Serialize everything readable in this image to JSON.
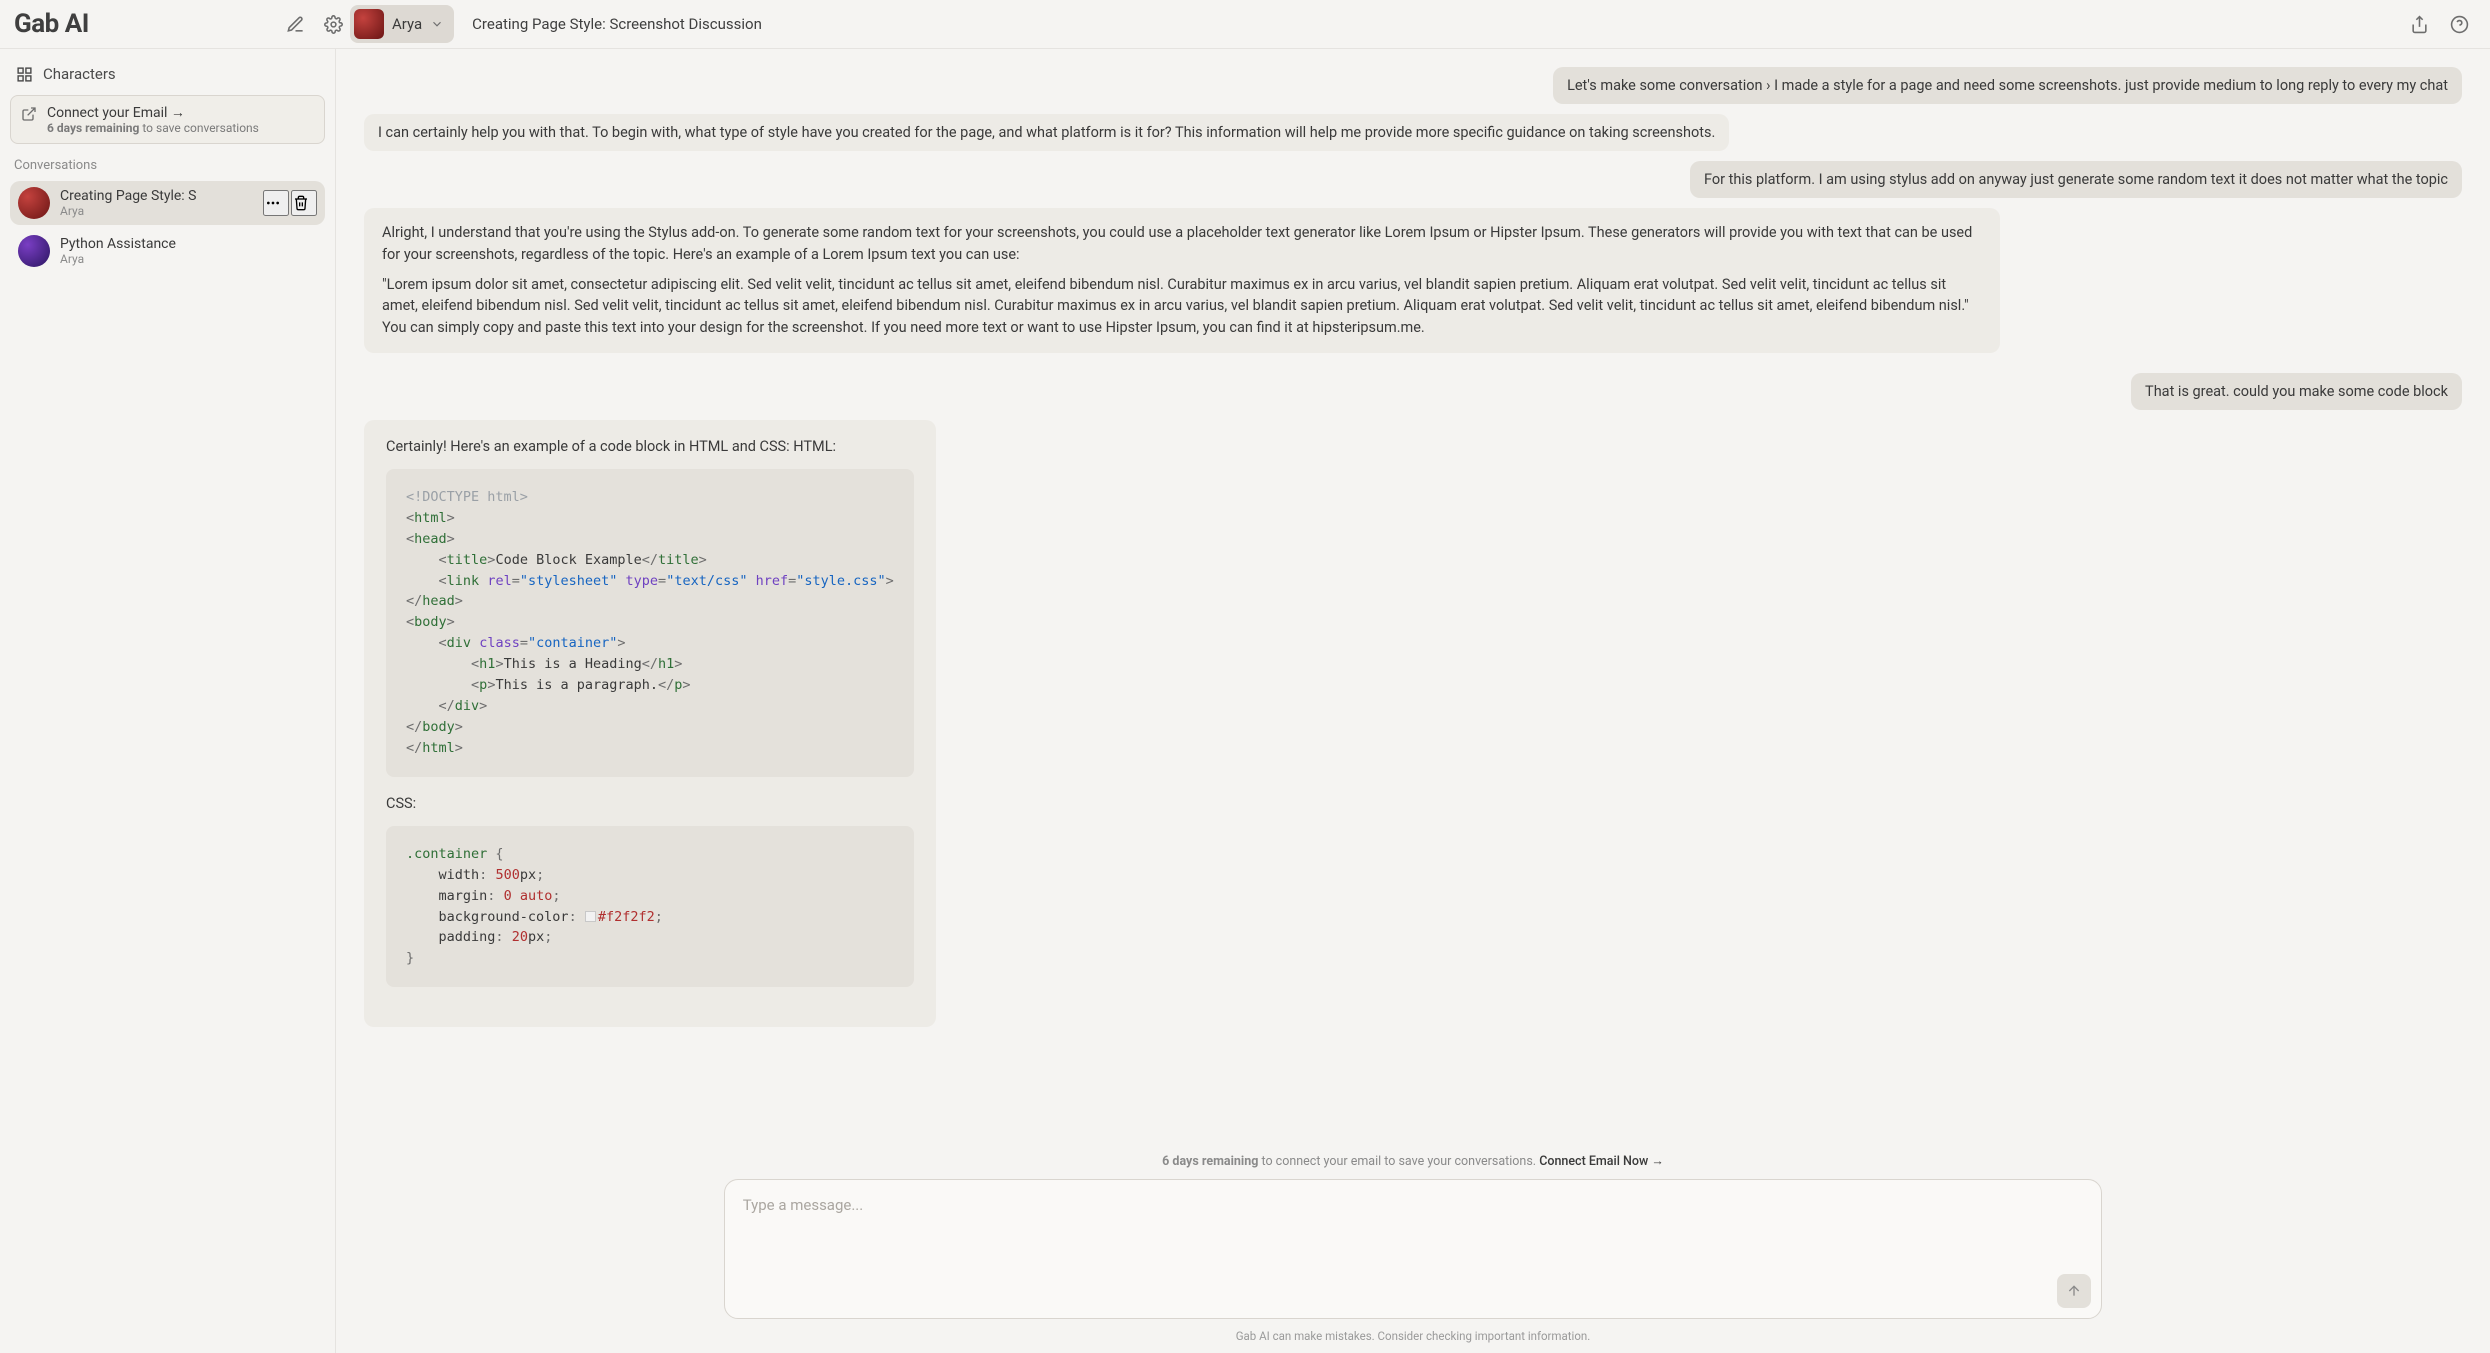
{
  "brand": "Gab AI",
  "header": {
    "persona_name": "Arya",
    "title": "Creating Page Style: Screenshot Discussion"
  },
  "sidebar": {
    "characters_label": "Characters",
    "connect": {
      "line1": "Connect your Email →",
      "line2_prefix": "6 days remaining",
      "line2_suffix": " to save conversations"
    },
    "group_label": "Conversations",
    "items": [
      {
        "title": "Creating Page Style: S",
        "sub": "Arya",
        "active": true,
        "has_actions": true
      },
      {
        "title": "Python Assistance",
        "sub": "Arya",
        "active": false,
        "has_actions": false
      }
    ]
  },
  "messages": {
    "u1": "Let's make some conversation › I made a style for a page and need some screenshots. just provide medium to long reply to every my chat",
    "a1": "I can certainly help you with that. To begin with, what type of style have you created for the page, and what platform is it for? This information will help me provide more specific guidance on taking screenshots.",
    "u2": "For this platform. I am using stylus add on anyway just generate some random text it does not matter what the topic",
    "a2_intro": "Alright, I understand that you're using the Stylus add-on. To generate some random text for your screenshots, you could use a placeholder text generator like Lorem Ipsum or Hipster Ipsum. These generators will provide you with text that can be used for your screenshots, regardless of the topic. Here's an example of a Lorem Ipsum text you can use:",
    "a2_quote": "\"Lorem ipsum dolor sit amet, consectetur adipiscing elit. Sed velit velit, tincidunt ac tellus sit amet, eleifend bibendum nisl. Curabitur maximus ex in arcu varius, vel blandit sapien pretium. Aliquam erat volutpat. Sed velit velit, tincidunt ac tellus sit amet, eleifend bibendum nisl. Sed velit velit, tincidunt ac tellus sit amet, eleifend bibendum nisl. Curabitur maximus ex in arcu varius, vel blandit sapien pretium. Aliquam erat volutpat. Sed velit velit, tincidunt ac tellus sit amet, eleifend bibendum nisl.\" You can simply copy and paste this text into your design for the screenshot. If you need more text or want to use Hipster Ipsum, you can find it at hipsteripsum.me.",
    "u3": "That is great. could you make some code block",
    "a3_intro": "Certainly! Here's an example of a code block in HTML and CSS: HTML:",
    "css_label": "CSS:"
  },
  "code": {
    "html": {
      "doctype": "<!DOCTYPE html>",
      "html_open": "html",
      "head_open": "head",
      "title_tag": "title",
      "title_text": "Code Block Example",
      "link_tag": "link",
      "rel_attr": "rel",
      "rel_val": "\"stylesheet\"",
      "type_attr": "type",
      "type_val": "\"text/css\"",
      "href_attr": "href",
      "href_val": "\"style.css\"",
      "body_open": "body",
      "div_tag": "div",
      "class_attr": "class",
      "class_val": "\"container\"",
      "h1_tag": "h1",
      "h1_text": "This is a Heading",
      "p_tag": "p",
      "p_text": "This is a paragraph."
    },
    "css": {
      "selector": ".container",
      "width_prop": "width",
      "width_val": "500",
      "width_unit": "px",
      "margin_prop": "margin",
      "margin_val": "0 auto",
      "bg_prop": "background-color",
      "bg_val": "#f2f2f2",
      "padding_prop": "padding",
      "padding_val": "20",
      "padding_unit": "px"
    }
  },
  "footer": {
    "notice_bold": "6 days remaining",
    "notice_mid": " to connect your email to save your conversations. ",
    "notice_link": "Connect Email Now →",
    "placeholder": "Type a message...",
    "disclaimer": "Gab AI can make mistakes. Consider checking important information."
  }
}
